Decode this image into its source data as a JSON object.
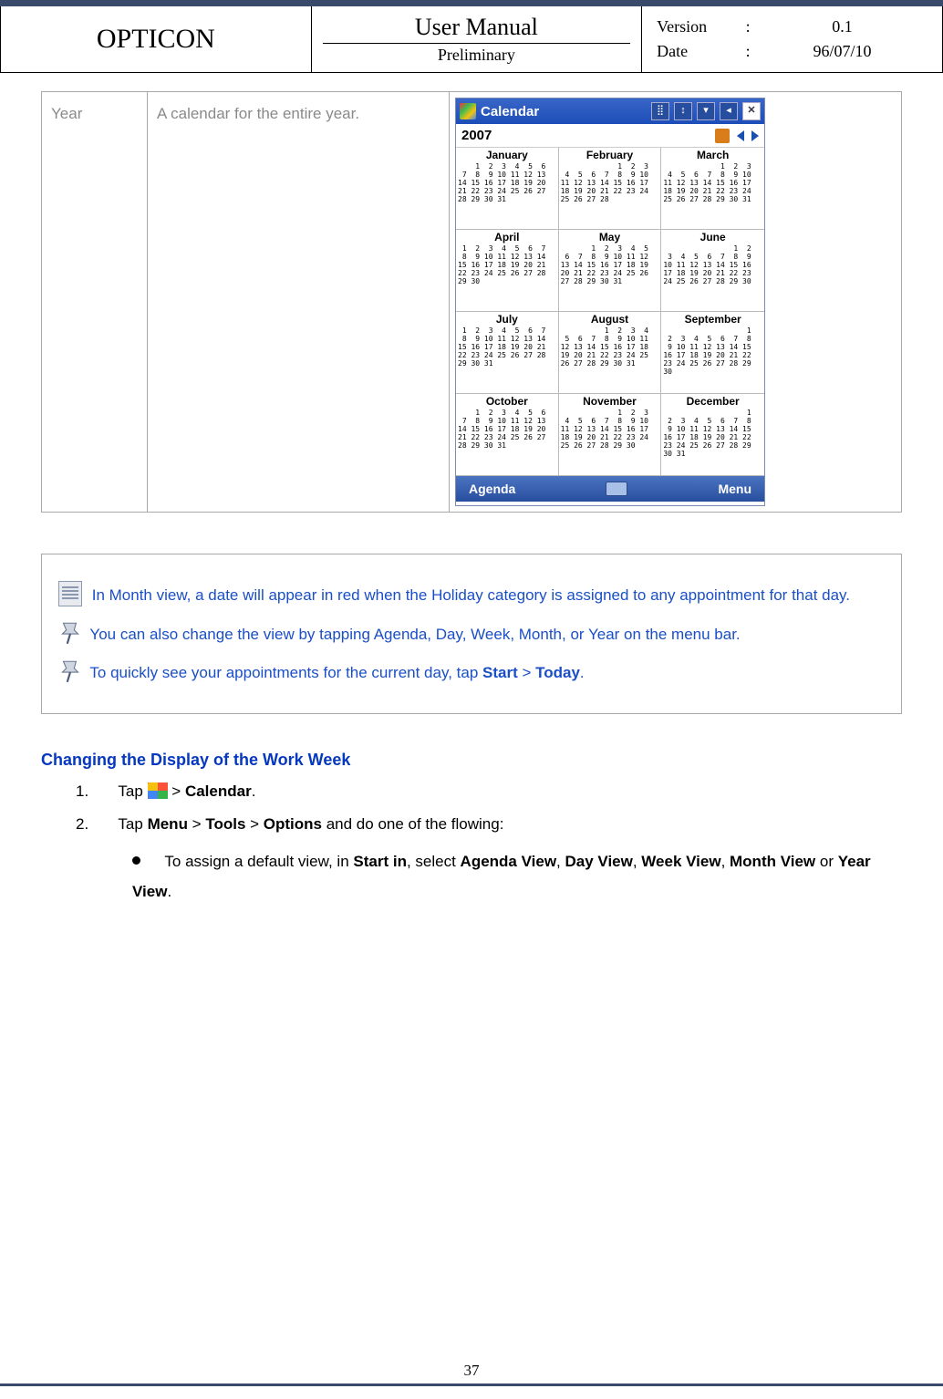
{
  "header": {
    "brand": "OPTICON",
    "title": "User Manual",
    "subtitle": "Preliminary",
    "version_label": "Version",
    "version_value": "0.1",
    "date_label": "Date",
    "date_value": "96/07/10"
  },
  "year_row": {
    "name": "Year",
    "desc": "A calendar for the entire year."
  },
  "screenshot": {
    "title": "Calendar",
    "year": "2007",
    "soft_left": "Agenda",
    "soft_right": "Menu",
    "months": [
      "January",
      "February",
      "March",
      "April",
      "May",
      "June",
      "July",
      "August",
      "September",
      "October",
      "November",
      "December"
    ]
  },
  "notes": {
    "n1": "In Month view, a date will appear in red when the Holiday category is assigned to any appointment for that day.",
    "n2": "You can also change the view by tapping Agenda, Day, Week, Month, or Year on the menu bar.",
    "n3_pre": "To quickly see your appointments for the current day, tap ",
    "n3_b1": "Start",
    "n3_gt": " > ",
    "n3_b2": "Today",
    "n3_post": "."
  },
  "section": {
    "heading": "Changing the Display of the Work Week",
    "step1_num": "1.",
    "step1_pre": "Tap ",
    "step1_gt": " > ",
    "step1_b": "Calendar",
    "step1_post": ".",
    "step2_num": "2.",
    "step2_pre": "Tap ",
    "step2_b1": "Menu",
    "step2_b2": "Tools",
    "step2_b3": "Options",
    "step2_mid": " and do one of the flowing:",
    "bullet_pre": "To assign a default view, in ",
    "bullet_b1": "Start in",
    "bullet_mid": ", select ",
    "bullet_b2": "Agenda View",
    "bullet_b3": "Day View",
    "bullet_b4": "Week View",
    "bullet_b5": "Month View",
    "bullet_b6": "Year View",
    "bullet_or": " or ",
    "bullet_comma": ", ",
    "bullet_post": "."
  },
  "page_number": "37"
}
